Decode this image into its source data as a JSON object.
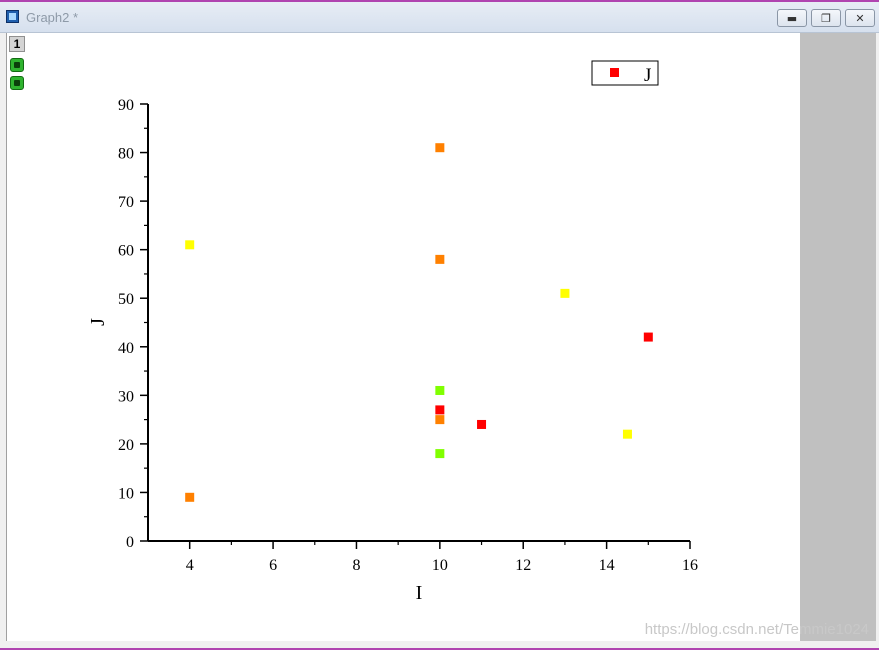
{
  "window": {
    "title": "Graph2 *",
    "layer_label": "1",
    "minimize_icon": "minimize-icon",
    "restore_icon": "restore-icon",
    "close_icon": "close-icon"
  },
  "watermark": "https://blog.csdn.net/Temmie1024",
  "chart_data": {
    "type": "scatter",
    "xlabel": "I",
    "ylabel": "J",
    "xlim": [
      3,
      16
    ],
    "ylim": [
      0,
      90
    ],
    "xticks": [
      4,
      6,
      8,
      10,
      12,
      14,
      16
    ],
    "yticks": [
      0,
      10,
      20,
      30,
      40,
      50,
      60,
      70,
      80,
      90
    ],
    "grid": false,
    "legend": {
      "position": "top-right",
      "entries": [
        {
          "label": "J",
          "color": "#ff0000"
        }
      ]
    },
    "points": [
      {
        "x": 4,
        "y": 61,
        "color": "#ffff00"
      },
      {
        "x": 4,
        "y": 9,
        "color": "#ff8000"
      },
      {
        "x": 10,
        "y": 81,
        "color": "#ff8000"
      },
      {
        "x": 10,
        "y": 58,
        "color": "#ff8000"
      },
      {
        "x": 10,
        "y": 31,
        "color": "#80ff00"
      },
      {
        "x": 10,
        "y": 27,
        "color": "#ff0000"
      },
      {
        "x": 10,
        "y": 25,
        "color": "#ff8000"
      },
      {
        "x": 10,
        "y": 18,
        "color": "#80ff00"
      },
      {
        "x": 11,
        "y": 24,
        "color": "#ff0000"
      },
      {
        "x": 13,
        "y": 51,
        "color": "#ffff00"
      },
      {
        "x": 14.5,
        "y": 22,
        "color": "#ffff00"
      },
      {
        "x": 15,
        "y": 42,
        "color": "#ff0000"
      }
    ]
  }
}
